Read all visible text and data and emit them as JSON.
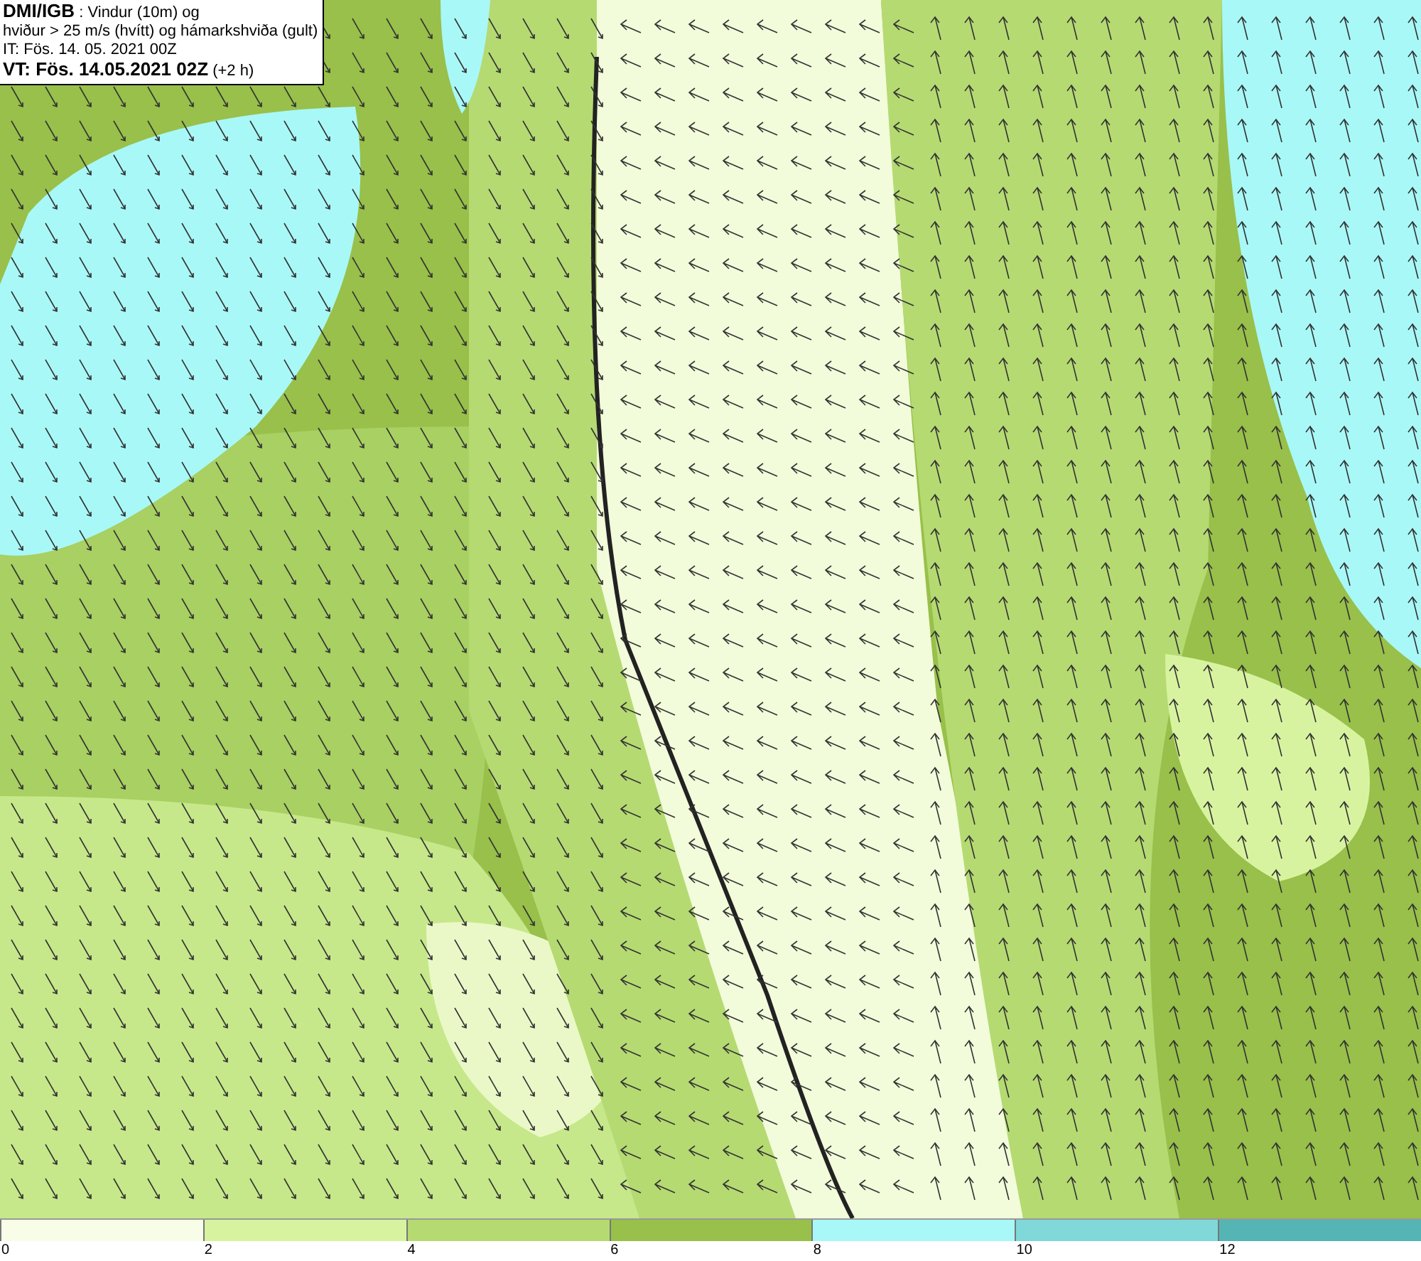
{
  "map": {
    "title_lines": [
      "**DMI/IGB** : Vindur (10m) og",
      "hviður > 25 m/s (hvítt) og hámarkshviða (gult)",
      "IT: Fös. 14. 05. 2021 00Z",
      "**VT: Fös. 14.05.2021 02Z** (+2 h)"
    ]
  },
  "legend": [
    {
      "label": "0",
      "color": "#f7fde6"
    },
    {
      "label": "2",
      "color": "#d8f3a0"
    },
    {
      "label": "4",
      "color": "#b5da72"
    },
    {
      "label": "6",
      "color": "#98c04a"
    },
    {
      "label": "8",
      "color": "#a9f8f8"
    },
    {
      "label": "10",
      "color": "#80d8d8"
    },
    {
      "label": "12",
      "color": "#55b4b4"
    }
  ]
}
